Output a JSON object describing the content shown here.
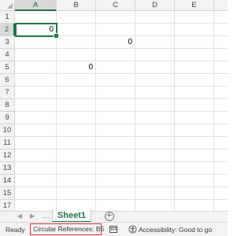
{
  "sheet": {
    "columns": [
      "A",
      "B",
      "C",
      "D",
      "E"
    ],
    "rows": [
      "1",
      "2",
      "3",
      "4",
      "5",
      "6",
      "7",
      "8",
      "9",
      "10",
      "11",
      "12",
      "13",
      "14",
      "15",
      "16",
      "17"
    ],
    "selected_column": "A",
    "selected_row": "2",
    "cells": [
      {
        "ref": "A2",
        "value": "0"
      },
      {
        "ref": "C3",
        "value": "0"
      },
      {
        "ref": "B5",
        "value": "0"
      }
    ]
  },
  "tabs": {
    "more_indicator": "...",
    "sheet1": "Sheet1",
    "add_label": "+"
  },
  "status": {
    "ready": "Ready",
    "circular_references": "Circular References: B5",
    "accessibility": "Accessibility: Good to go"
  },
  "colors": {
    "accent": "#217346",
    "circular_highlight": "#d13438"
  },
  "icons": [
    "select-all-triangle-icon",
    "prev-sheet-icon",
    "next-sheet-icon",
    "add-sheet-icon",
    "calendar-icon",
    "accessibility-icon"
  ]
}
